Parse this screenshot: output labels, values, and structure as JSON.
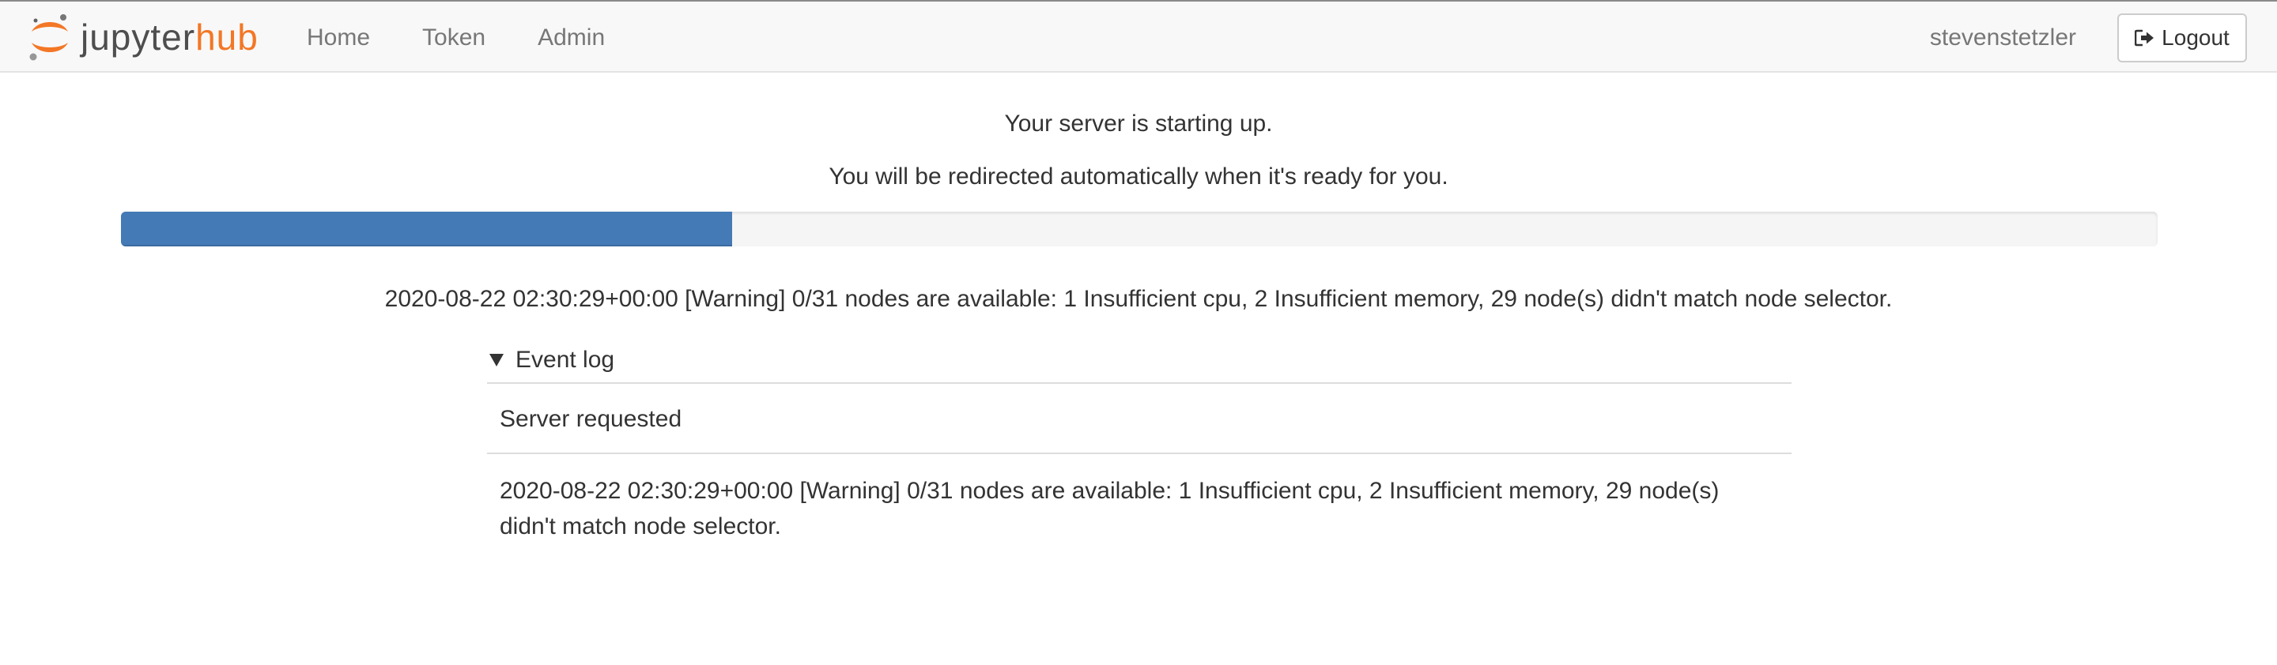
{
  "brand": {
    "name_part1": "jupyter",
    "name_part2": "hub",
    "logo_icon": "jupyter-logo-icon",
    "accent_color": "#f37726"
  },
  "nav": {
    "items": [
      {
        "label": "Home"
      },
      {
        "label": "Token"
      },
      {
        "label": "Admin"
      }
    ]
  },
  "user": {
    "name": "stevenstetzler",
    "logout_label": "Logout",
    "logout_icon": "sign-out-icon"
  },
  "main": {
    "starting_message": "Your server is starting up.",
    "redirect_message": "You will be redirected automatically when it's ready for you.",
    "progress": {
      "percent": 30,
      "bar_color": "#447ab5"
    },
    "status_message": "2020-08-22 02:30:29+00:00 [Warning] 0/31 nodes are available: 1 Insufficient cpu, 2 Insufficient memory, 29 node(s) didn't match node selector."
  },
  "event_log": {
    "summary_label": "Event log",
    "toggle_icon": "triangle-down-icon",
    "events": [
      {
        "message": "Server requested"
      },
      {
        "message": "2020-08-22 02:30:29+00:00 [Warning] 0/31 nodes are available: 1 Insufficient cpu, 2 Insufficient memory, 29 node(s) didn't match node selector."
      }
    ]
  }
}
